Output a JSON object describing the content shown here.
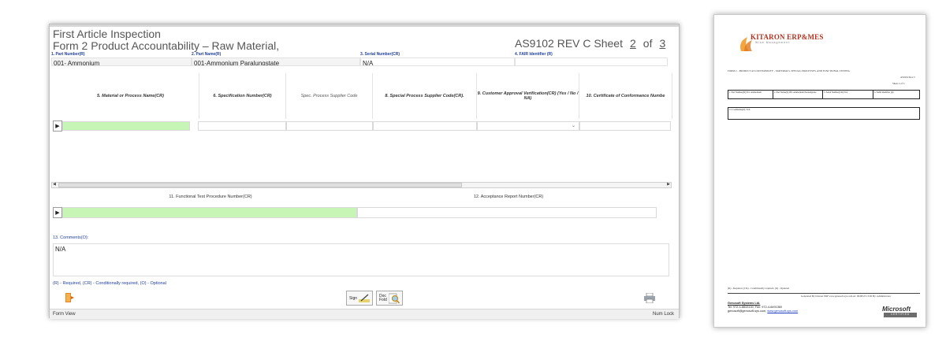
{
  "form": {
    "title_line1": "First Article Inspection",
    "title_line2": "Form 2 Product Accountability – Raw Material,",
    "standard": "AS9102 REV C Sheet",
    "sheet_current": "2",
    "of_label": "of",
    "sheet_total": "3",
    "fields": {
      "part_number_label": "1. Part Number(R)",
      "part_number_value": "001- Ammonium",
      "part_name_label": "2. Part Name(R)",
      "part_name_value": "001-Ammonium Paralungstate",
      "serial_label": "3. Serial Number(CR)",
      "serial_value": "N/A",
      "fair_label": "4. FAIR Identifier (R)",
      "fair_value": ""
    },
    "grid": {
      "col_material": "5. Material or Process Name(CR)",
      "col_spec": "6. Specification Number(CR)",
      "col_supplier": "Spec. Process Supplier Code",
      "col_special": "8. Special Process Supplier Code(CR).",
      "col_customer": "9. Customer Approval Verification(CR) (Yes / No / NA)",
      "col_certificate": "10. Certificate of Conformance Numbe"
    },
    "functional_test_label": "11. Functional Test Procedure Number(CR)",
    "acceptance_label": "12. Acceptance Report Number(CR)",
    "comments_label": "13. Comments(O):",
    "comments_value": "N/A",
    "legend": "(R) - Required, (CR) - Conditionally required, (O) - Optional",
    "sign_label": "Sign",
    "doc_label": "Doc Fold",
    "status_left": "Form View",
    "status_right": "Num Lock"
  },
  "document": {
    "logo_text": "KITARON ERP&MES",
    "logo_sub": "Wise Management",
    "form_line": "FORM 2 – PRODUCT ACCOUNTABILITY – MATERIALS, SPECIAL PROCESSES, AND FUNCTIONAL TESTING",
    "rev": "AS9102 Rev C",
    "sheet_line": "Sheet   2   of   3",
    "cells": [
      "1. Part Number(R) 001- Ammonium",
      "2. Part Name(R) 001-Ammonium Paratungstate",
      "3. Serial Number(CR) N/A",
      "4. FAIR Identifier (R)"
    ],
    "comments": "13. Comments(O): N/A",
    "footer_legend": "(R) - Required, (CR) - Conditionally required, (O) - Optional",
    "generated": "Generated By Kitaron ERP www.genosoft-sys.com  At: 09/08/23 13:00   By: Administrator",
    "company_name": "Genosoft Systems Ltd.",
    "company_tel": "Tel: 972-4-8833130, Fax: 972-4-8491360",
    "company_email": "genosoft@genosoft-sys.com,",
    "company_web": "www.genosoft-sys.com",
    "ms_logo": "Microsoft",
    "ms_cert": "CERTIFIED"
  },
  "colors": {
    "label_blue": "#203f9a",
    "active_green": "#c6f5b6",
    "logo_red": "#b4321f"
  }
}
